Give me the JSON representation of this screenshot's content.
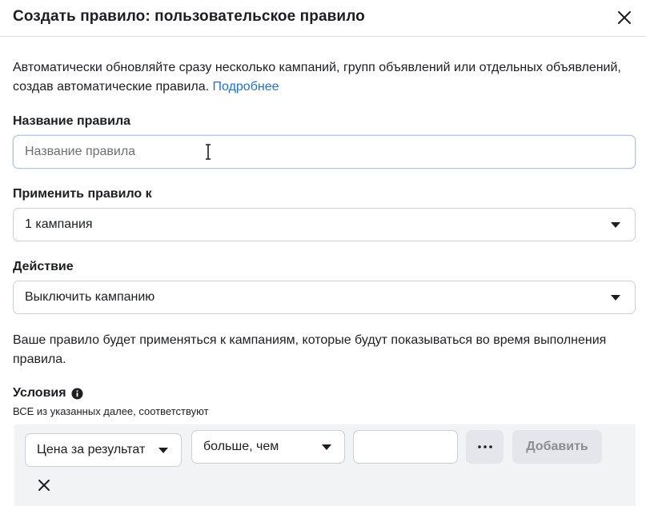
{
  "dialog": {
    "title": "Создать правило: пользовательское правило",
    "close_icon": "close-icon"
  },
  "intro": {
    "text": "Автоматически обновляйте сразу несколько кампаний, групп объявлений или отдельных объявлений, создав автоматические правила. ",
    "link": "Подробнее"
  },
  "rule_name": {
    "label": "Название правила",
    "value": "",
    "placeholder": "Название правила"
  },
  "apply_to": {
    "label": "Применить правило к",
    "selected": "1 кампания"
  },
  "action": {
    "label": "Действие",
    "selected": "Выключить кампанию"
  },
  "note": "Ваше правило будет применяться к кампаниям, которые будут показываться во время выполнения правила.",
  "conditions": {
    "label": "Условия",
    "info_icon": "info-icon",
    "subtitle": "ВСЕ из указанных далее, соответствуют",
    "metric": "Цена за результат",
    "operator": "больше, чем",
    "value": "",
    "more_label": "•••",
    "add_label": "Добавить"
  },
  "colors": {
    "link": "#216fdb",
    "text": "#1c1e21",
    "disabled_button": "#e4e6eb",
    "conditions_bg": "#f2f3f5"
  }
}
